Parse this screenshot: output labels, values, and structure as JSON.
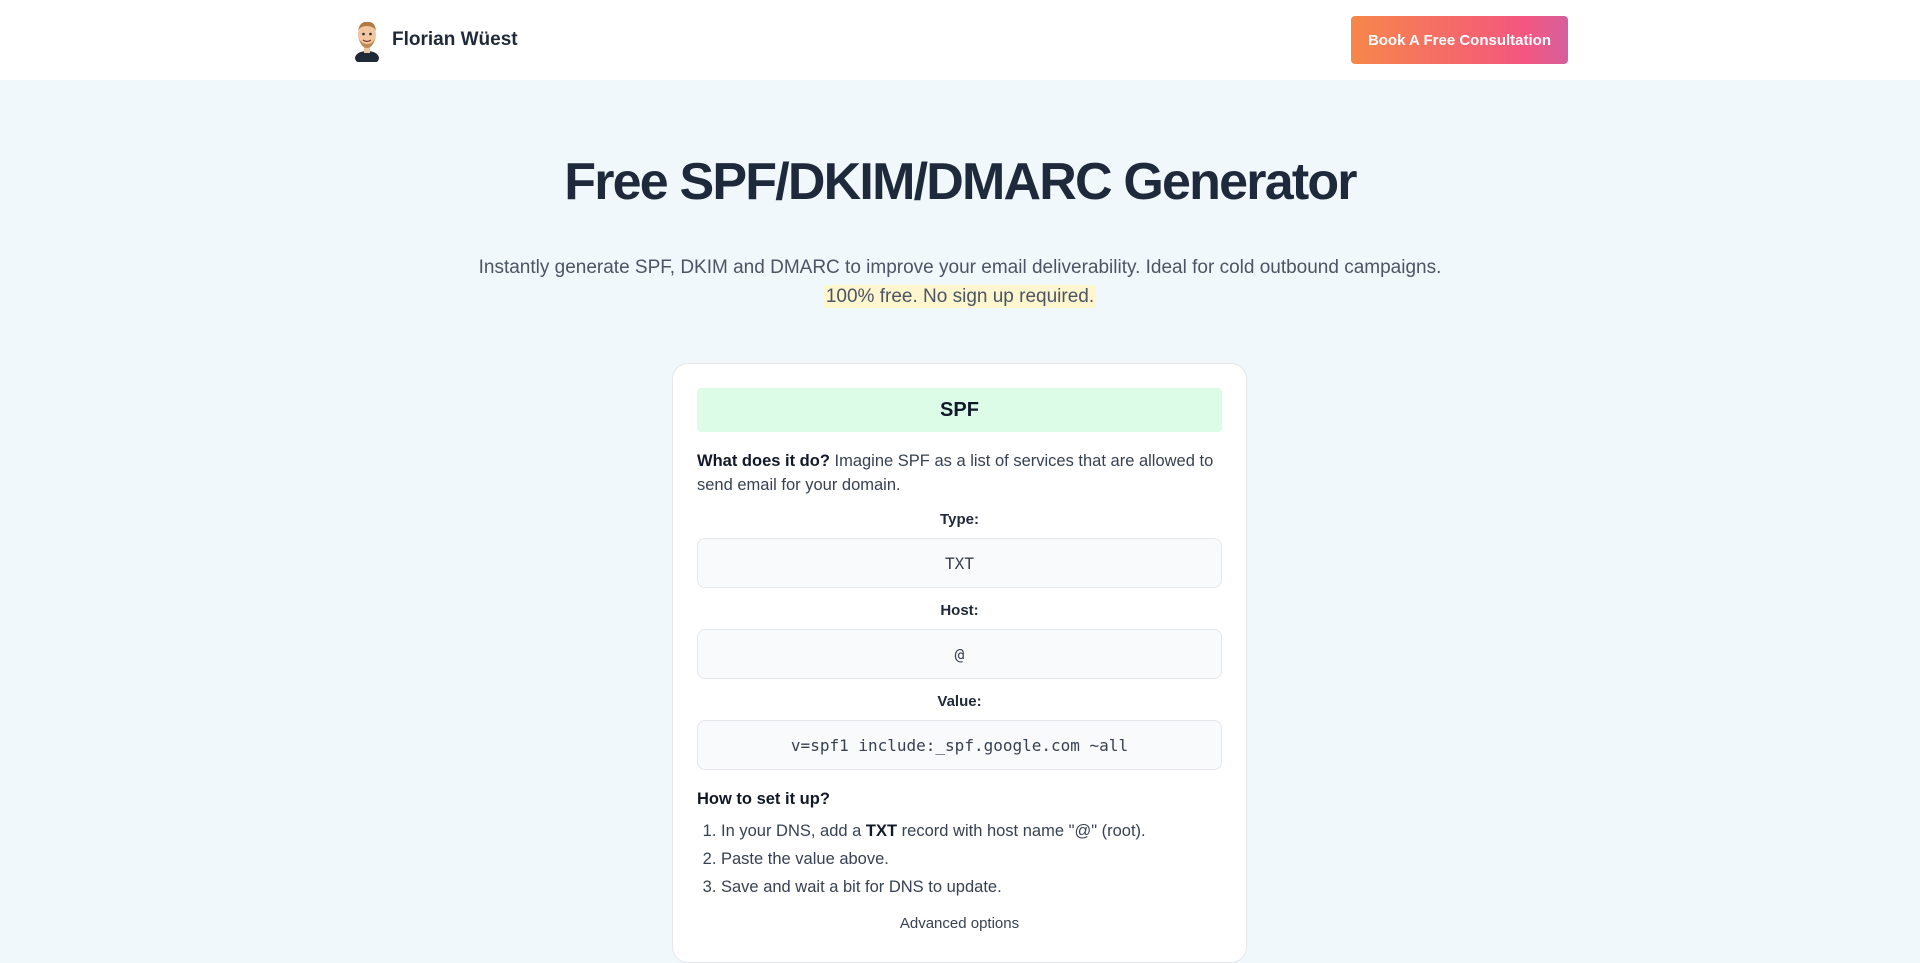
{
  "header": {
    "brand_name": "Florian Wüest",
    "cta_label": "Book A Free Consultation"
  },
  "hero": {
    "title": "Free SPF/DKIM/DMARC Generator",
    "subtitle": "Instantly generate SPF, DKIM and DMARC to improve your email deliverability. Ideal for cold outbound campaigns.",
    "highlight": "100% free. No sign up required."
  },
  "spf_card": {
    "title": "SPF",
    "desc_bold": "What does it do?",
    "desc_text": " Imagine SPF as a list of services that are allowed to send email for your domain.",
    "type_label": "Type:",
    "type_value": "TXT",
    "host_label": "Host:",
    "host_value": "@",
    "value_label": "Value:",
    "value_value": "v=spf1 include:_spf.google.com ~all",
    "howto_title": "How to set it up?",
    "steps": {
      "s1_pre": "In your DNS, add a ",
      "s1_bold": "TXT",
      "s1_post": " record with host name \"@\" (root).",
      "s2": "Paste the value above.",
      "s3": "Save and wait a bit for DNS to update."
    },
    "advanced_label": "Advanced options"
  }
}
